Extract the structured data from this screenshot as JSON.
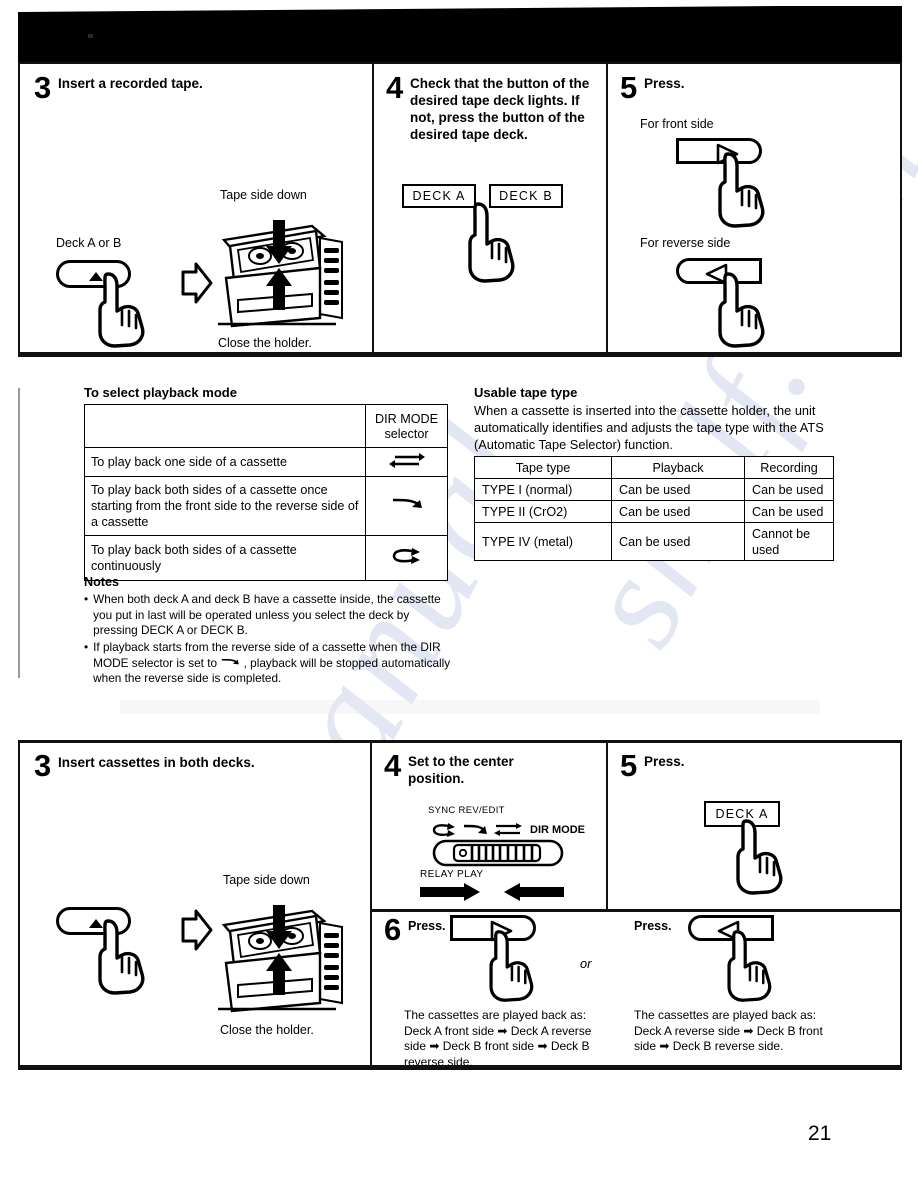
{
  "page": {
    "number": "21"
  },
  "top_section": {
    "step3": {
      "number": "3",
      "heading": "Insert a recorded tape.",
      "eject_label": "Deck A or B",
      "tape_label": "Tape side down",
      "holder_label": "Close the holder."
    },
    "step4": {
      "number": "4",
      "heading": "Check that the button of the desired tape deck lights. If not, press the button of the desired tape deck.",
      "buttons": [
        "DECK A",
        "DECK B"
      ]
    },
    "step5": {
      "number": "5",
      "heading": "Press.",
      "front_label": "For front side",
      "reverse_label": "For reverse side"
    }
  },
  "playback_mode": {
    "title": "To select playback mode",
    "column_header_line1": "DIR MODE",
    "column_header_line2": "selector",
    "rows": [
      {
        "description": "To play back one side of a cassette",
        "symbol": "one-side-icon"
      },
      {
        "description": "To play back both sides of a cassette once starting from the front side to the reverse side of a cassette",
        "symbol": "both-sides-once-icon"
      },
      {
        "description": "To play back both sides of a cassette continuously",
        "symbol": "both-sides-loop-icon"
      }
    ]
  },
  "usable_tape": {
    "title": "Usable tape type",
    "paragraph": "When a cassette is inserted into the cassette holder, the unit automatically identifies and adjusts the tape type with the ATS (Automatic Tape Selector) function.",
    "headers": [
      "Tape type",
      "Playback",
      "Recording"
    ],
    "rows": [
      [
        "TYPE I (normal)",
        "Can be used",
        "Can be used"
      ],
      [
        "TYPE II (CrO2)",
        "Can be used",
        "Can be used"
      ],
      [
        "TYPE IV (metal)",
        "Can be used",
        "Cannot be used"
      ]
    ]
  },
  "notes": {
    "title": "Notes",
    "bullet": "•",
    "items": [
      "When both deck A and deck B have a cassette inside, the cassette you put in last will be operated unless you select the deck by pressing DECK A or DECK B.",
      "If playback starts from the reverse side of a cassette when the DIR MODE selector is set to ⇄ , playback will be stopped automatically when the reverse side is completed."
    ],
    "note2_part1": "If playback starts from the reverse side of a cassette when the",
    "note2_part2": "DIR MODE selector is set to",
    "note2_part3": ", playback will be stopped",
    "note2_part4": "automatically when the reverse side is completed."
  },
  "bottom_section": {
    "step3": {
      "number": "3",
      "heading": "Insert cassettes in both decks.",
      "tape_label": "Tape side down",
      "holder_label": "Close the holder."
    },
    "step4": {
      "number": "4",
      "heading": "Set to the center position.",
      "slider_top_label": "SYNC REV/EDIT",
      "slider_right_label": "DIR MODE",
      "slider_bottom_label": "RELAY PLAY"
    },
    "step5": {
      "number": "5",
      "heading": "Press.",
      "button": "DECK A"
    },
    "step6": {
      "number": "6",
      "heading": "Press.",
      "or": "or",
      "left_heading": "Press.",
      "left_caption": "The cassettes are played back as: Deck A front side ➡ Deck A reverse side ➡ Deck B front side ➡ Deck B reverse side.",
      "right_heading": "Press.",
      "right_caption": "The cassettes are played back as: Deck A reverse side ➡ Deck B front side ➡ Deck B reverse side."
    }
  },
  "watermark": {
    "text": "manualshelf.com"
  }
}
